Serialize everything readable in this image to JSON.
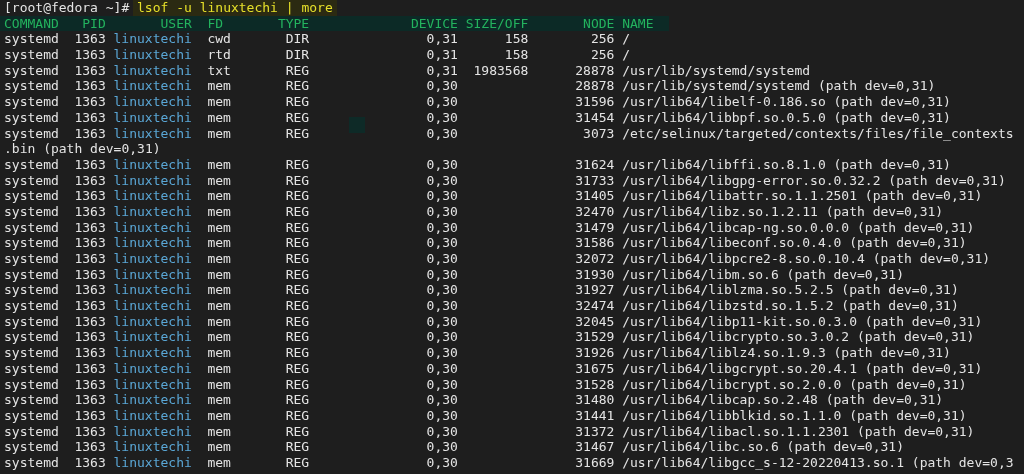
{
  "terminal": {
    "prompt": "[root@fedora ~]#",
    "command": "lsof -u linuxtechi | more",
    "columns": [
      "COMMAND",
      "PID",
      "USER",
      "FD",
      "TYPE",
      "DEVICE",
      "SIZE/OFF",
      "NODE",
      "NAME"
    ],
    "lines": [
      {
        "kind": "row",
        "command": "systemd",
        "pid": "1363",
        "user": "linuxtechi",
        "fd": "cwd",
        "type": "DIR",
        "device": "0,31",
        "size_off": "158",
        "node": "256",
        "name": "/"
      },
      {
        "kind": "row",
        "command": "systemd",
        "pid": "1363",
        "user": "linuxtechi",
        "fd": "rtd",
        "type": "DIR",
        "device": "0,31",
        "size_off": "158",
        "node": "256",
        "name": "/"
      },
      {
        "kind": "row",
        "command": "systemd",
        "pid": "1363",
        "user": "linuxtechi",
        "fd": "txt",
        "type": "REG",
        "device": "0,31",
        "size_off": "1983568",
        "node": "28878",
        "name": "/usr/lib/systemd/systemd"
      },
      {
        "kind": "row",
        "command": "systemd",
        "pid": "1363",
        "user": "linuxtechi",
        "fd": "mem",
        "type": "REG",
        "device": "0,30",
        "node": "28878",
        "name": "/usr/lib/systemd/systemd (path dev=0,31)"
      },
      {
        "kind": "row",
        "command": "systemd",
        "pid": "1363",
        "user": "linuxtechi",
        "fd": "mem",
        "type": "REG",
        "device": "0,30",
        "node": "31596",
        "name": "/usr/lib64/libelf-0.186.so (path dev=0,31)"
      },
      {
        "kind": "row",
        "command": "systemd",
        "pid": "1363",
        "user": "linuxtechi",
        "fd": "mem",
        "type": "REG",
        "device": "0,30",
        "node": "31454",
        "name": "/usr/lib64/libbpf.so.0.5.0 (path dev=0,31)"
      },
      {
        "kind": "row",
        "command": "systemd",
        "pid": "1363",
        "user": "linuxtechi",
        "fd": "mem",
        "type": "REG",
        "device": "0,30",
        "node": "3073",
        "name": "/etc/selinux/targeted/contexts/files/file_contexts"
      },
      {
        "kind": "continuation",
        "text": ".bin (path dev=0,31)"
      },
      {
        "kind": "row",
        "command": "systemd",
        "pid": "1363",
        "user": "linuxtechi",
        "fd": "mem",
        "type": "REG",
        "device": "0,30",
        "node": "31624",
        "name": "/usr/lib64/libffi.so.8.1.0 (path dev=0,31)"
      },
      {
        "kind": "row",
        "command": "systemd",
        "pid": "1363",
        "user": "linuxtechi",
        "fd": "mem",
        "type": "REG",
        "device": "0,30",
        "node": "31733",
        "name": "/usr/lib64/libgpg-error.so.0.32.2 (path dev=0,31)"
      },
      {
        "kind": "row",
        "command": "systemd",
        "pid": "1363",
        "user": "linuxtechi",
        "fd": "mem",
        "type": "REG",
        "device": "0,30",
        "node": "31405",
        "name": "/usr/lib64/libattr.so.1.1.2501 (path dev=0,31)"
      },
      {
        "kind": "row",
        "command": "systemd",
        "pid": "1363",
        "user": "linuxtechi",
        "fd": "mem",
        "type": "REG",
        "device": "0,30",
        "node": "32470",
        "name": "/usr/lib64/libz.so.1.2.11 (path dev=0,31)"
      },
      {
        "kind": "row",
        "command": "systemd",
        "pid": "1363",
        "user": "linuxtechi",
        "fd": "mem",
        "type": "REG",
        "device": "0,30",
        "node": "31479",
        "name": "/usr/lib64/libcap-ng.so.0.0.0 (path dev=0,31)"
      },
      {
        "kind": "row",
        "command": "systemd",
        "pid": "1363",
        "user": "linuxtechi",
        "fd": "mem",
        "type": "REG",
        "device": "0,30",
        "node": "31586",
        "name": "/usr/lib64/libeconf.so.0.4.0 (path dev=0,31)"
      },
      {
        "kind": "row",
        "command": "systemd",
        "pid": "1363",
        "user": "linuxtechi",
        "fd": "mem",
        "type": "REG",
        "device": "0,30",
        "node": "32072",
        "name": "/usr/lib64/libpcre2-8.so.0.10.4 (path dev=0,31)"
      },
      {
        "kind": "row",
        "command": "systemd",
        "pid": "1363",
        "user": "linuxtechi",
        "fd": "mem",
        "type": "REG",
        "device": "0,30",
        "node": "31930",
        "name": "/usr/lib64/libm.so.6 (path dev=0,31)"
      },
      {
        "kind": "row",
        "command": "systemd",
        "pid": "1363",
        "user": "linuxtechi",
        "fd": "mem",
        "type": "REG",
        "device": "0,30",
        "node": "31927",
        "name": "/usr/lib64/liblzma.so.5.2.5 (path dev=0,31)"
      },
      {
        "kind": "row",
        "command": "systemd",
        "pid": "1363",
        "user": "linuxtechi",
        "fd": "mem",
        "type": "REG",
        "device": "0,30",
        "node": "32474",
        "name": "/usr/lib64/libzstd.so.1.5.2 (path dev=0,31)"
      },
      {
        "kind": "row",
        "command": "systemd",
        "pid": "1363",
        "user": "linuxtechi",
        "fd": "mem",
        "type": "REG",
        "device": "0,30",
        "node": "32045",
        "name": "/usr/lib64/libp11-kit.so.0.3.0 (path dev=0,31)"
      },
      {
        "kind": "row",
        "command": "systemd",
        "pid": "1363",
        "user": "linuxtechi",
        "fd": "mem",
        "type": "REG",
        "device": "0,30",
        "node": "31529",
        "name": "/usr/lib64/libcrypto.so.3.0.2 (path dev=0,31)"
      },
      {
        "kind": "row",
        "command": "systemd",
        "pid": "1363",
        "user": "linuxtechi",
        "fd": "mem",
        "type": "REG",
        "device": "0,30",
        "node": "31926",
        "name": "/usr/lib64/liblz4.so.1.9.3 (path dev=0,31)"
      },
      {
        "kind": "row",
        "command": "systemd",
        "pid": "1363",
        "user": "linuxtechi",
        "fd": "mem",
        "type": "REG",
        "device": "0,30",
        "node": "31675",
        "name": "/usr/lib64/libgcrypt.so.20.4.1 (path dev=0,31)"
      },
      {
        "kind": "row",
        "command": "systemd",
        "pid": "1363",
        "user": "linuxtechi",
        "fd": "mem",
        "type": "REG",
        "device": "0,30",
        "node": "31528",
        "name": "/usr/lib64/libcrypt.so.2.0.0 (path dev=0,31)"
      },
      {
        "kind": "row",
        "command": "systemd",
        "pid": "1363",
        "user": "linuxtechi",
        "fd": "mem",
        "type": "REG",
        "device": "0,30",
        "node": "31480",
        "name": "/usr/lib64/libcap.so.2.48 (path dev=0,31)"
      },
      {
        "kind": "row",
        "command": "systemd",
        "pid": "1363",
        "user": "linuxtechi",
        "fd": "mem",
        "type": "REG",
        "device": "0,30",
        "node": "31441",
        "name": "/usr/lib64/libblkid.so.1.1.0 (path dev=0,31)"
      },
      {
        "kind": "row",
        "command": "systemd",
        "pid": "1363",
        "user": "linuxtechi",
        "fd": "mem",
        "type": "REG",
        "device": "0,30",
        "node": "31372",
        "name": "/usr/lib64/libacl.so.1.1.2301 (path dev=0,31)"
      },
      {
        "kind": "row",
        "command": "systemd",
        "pid": "1363",
        "user": "linuxtechi",
        "fd": "mem",
        "type": "REG",
        "device": "0,30",
        "node": "31467",
        "name": "/usr/lib64/libc.so.6 (path dev=0,31)"
      },
      {
        "kind": "row",
        "command": "systemd",
        "pid": "1363",
        "user": "linuxtechi",
        "fd": "mem",
        "type": "REG",
        "device": "0,30",
        "node": "31669",
        "name": "/usr/lib64/libgcc_s-12-20220413.so.1 (path dev=0,3"
      }
    ]
  }
}
